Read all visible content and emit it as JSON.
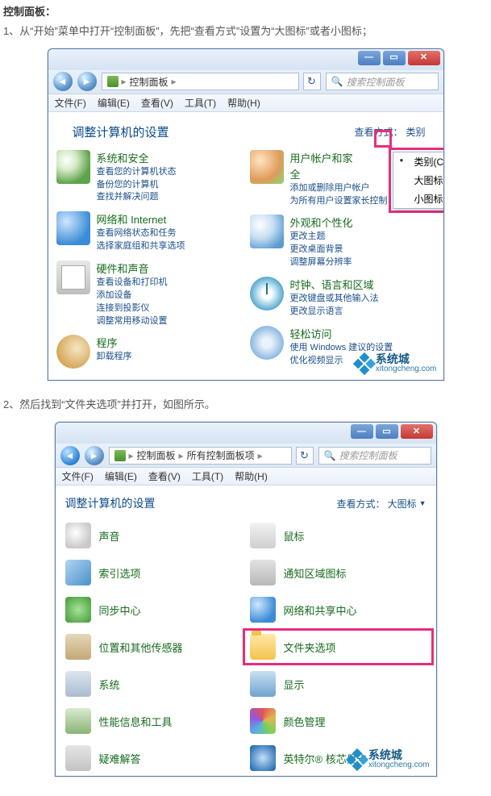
{
  "article": {
    "heading": "控制面板：",
    "step1": "1、从“开始”菜单中打开“控制面板”，先把“查看方式”设置为“大图标”或者小图标；",
    "step2": "2、然后找到“文件夹选项”并打开，如图所示。"
  },
  "watermark": {
    "brand": "系统城",
    "domain": "xitongcheng.com"
  },
  "shot1": {
    "address_seg": "控制面板",
    "search_placeholder": "搜索控制面板",
    "menus": [
      "文件(F)",
      "编辑(E)",
      "查看(V)",
      "工具(T)",
      "帮助(H)"
    ],
    "title": "调整计算机的设置",
    "view_label": "查看方式：",
    "view_partial": "类别",
    "view_menu": {
      "opt1": "类别(C)",
      "opt2": "大图标(L)",
      "opt3": "小图标(S)"
    },
    "left": [
      {
        "t": "系统和安全",
        "s": [
          "查看您的计算机状态",
          "备份您的计算机",
          "查找并解决问题"
        ]
      },
      {
        "t": "网络和 Internet",
        "s": [
          "查看网络状态和任务",
          "选择家庭组和共享选项"
        ]
      },
      {
        "t": "硬件和声音",
        "s": [
          "查看设备和打印机",
          "添加设备",
          "连接到投影仪",
          "调整常用移动设置"
        ]
      },
      {
        "t": "程序",
        "s": [
          "卸载程序"
        ]
      }
    ],
    "right": [
      {
        "t": "用户帐户和家",
        "t2": "全",
        "s": [
          "添加或删除用户帐户",
          "为所有用户设置家长控制"
        ]
      },
      {
        "t": "外观和个性化",
        "s": [
          "更改主题",
          "更改桌面背景",
          "调整屏幕分辨率"
        ]
      },
      {
        "t": "时钟、语言和区域",
        "s": [
          "更改键盘或其他输入法",
          "更改显示语言"
        ]
      },
      {
        "t": "轻松访问",
        "s": [
          "使用 Windows 建议的设置",
          "优化视频显示"
        ]
      }
    ]
  },
  "shot2": {
    "address_seg1": "控制面板",
    "address_seg2": "所有控制面板项",
    "search_placeholder": "搜索控制面板",
    "menus": [
      "文件(F)",
      "编辑(E)",
      "查看(V)",
      "工具(T)",
      "帮助(H)"
    ],
    "title": "调整计算机的设置",
    "view_label": "查看方式：",
    "view_value": "大图标",
    "items": {
      "l0": "声音",
      "r0": "鼠标",
      "l1": "索引选项",
      "r1": "通知区域图标",
      "l2": "同步中心",
      "r2": "网络和共享中心",
      "l3": "位置和其他传感器",
      "r3": "文件夹选项",
      "l4": "系统",
      "r4": "显示",
      "l5": "性能信息和工具",
      "r5": "颜色管理",
      "l6": "疑难解答",
      "r6": "英特尔® 核芯显卡"
    }
  }
}
